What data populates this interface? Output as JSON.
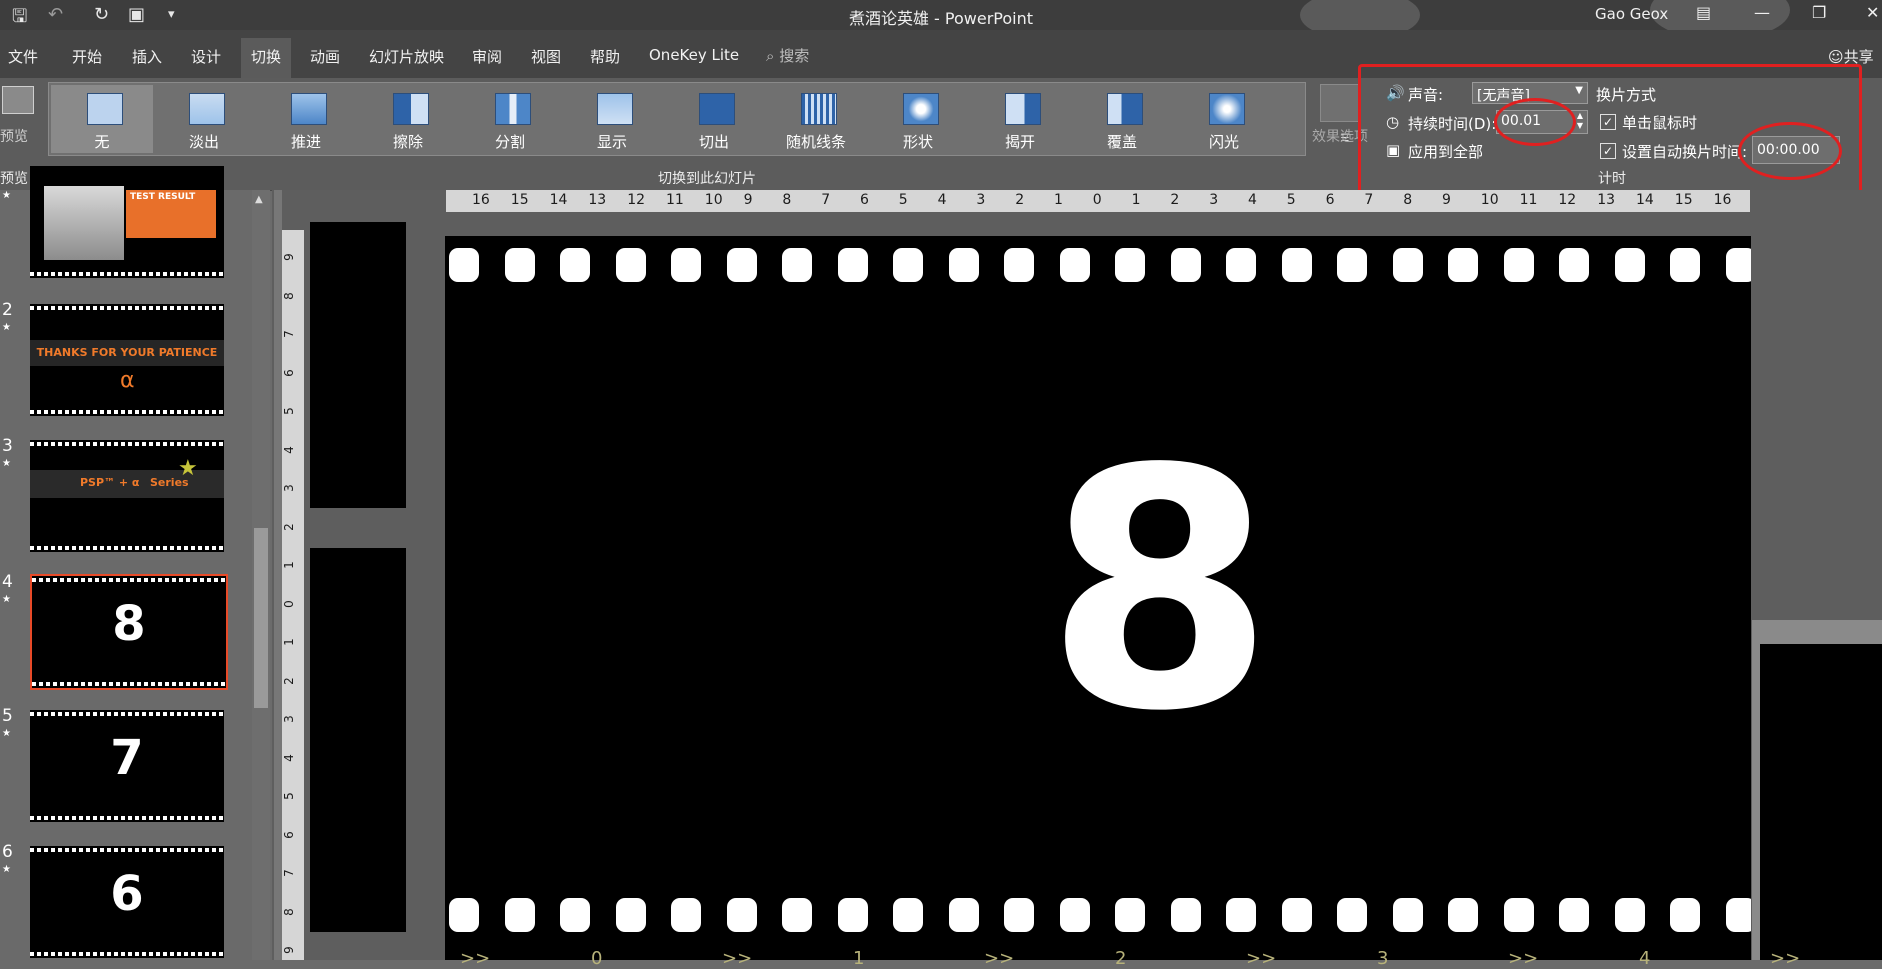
{
  "window": {
    "title": "煮酒论英雄  -  PowerPoint",
    "user": "Gao Geox"
  },
  "tabs": [
    "文件",
    "开始",
    "插入",
    "设计",
    "切换",
    "动画",
    "幻灯片放映",
    "审阅",
    "视图",
    "帮助",
    "OneKey Lite"
  ],
  "active_tab": "切换",
  "search_label": "搜索",
  "share_label": "共享",
  "ribbon": {
    "preview_label": "预览",
    "preview_group": "预览",
    "transitions": [
      "无",
      "淡出",
      "推进",
      "擦除",
      "分割",
      "显示",
      "切出",
      "随机线条",
      "形状",
      "揭开",
      "覆盖",
      "闪光"
    ],
    "selected_transition": "无",
    "effect_options": "效果选项",
    "transition_group": "切换到此幻灯片",
    "timing": {
      "sound_label": "声音:",
      "sound_value": "[无声音]",
      "duration_label": "持续时间(D):",
      "duration_value": "00.01",
      "apply_all": "应用到全部",
      "advance_header": "换片方式",
      "on_click": "单击鼠标时",
      "on_click_checked": true,
      "after_label": "设置自动换片时间:",
      "after_checked": true,
      "after_value": "00:00.00",
      "group_label": "计时"
    }
  },
  "slides": [
    {
      "number": "",
      "text": "TEST RESULT",
      "kind": "photo"
    },
    {
      "number": "2",
      "text": "THANKS FOR YOUR PATIENCE",
      "kind": "text"
    },
    {
      "number": "3",
      "text": "Series",
      "kind": "text"
    },
    {
      "number": "4",
      "text": "8",
      "kind": "count",
      "selected": true
    },
    {
      "number": "5",
      "text": "7",
      "kind": "count"
    },
    {
      "number": "6",
      "text": "6",
      "kind": "count"
    }
  ],
  "ruler_h": [
    "16",
    "15",
    "14",
    "13",
    "12",
    "11",
    "10",
    "9",
    "8",
    "7",
    "6",
    "5",
    "4",
    "3",
    "2",
    "1",
    "0",
    "1",
    "2",
    "3",
    "4",
    "5",
    "6",
    "7",
    "8",
    "9",
    "10",
    "11",
    "12",
    "13",
    "14",
    "15",
    "16"
  ],
  "ruler_v": [
    "9",
    "8",
    "7",
    "6",
    "5",
    "4",
    "3",
    "2",
    "1",
    "0",
    "1",
    "2",
    "3",
    "4",
    "5",
    "6",
    "7",
    "8",
    "9"
  ],
  "main_slide": {
    "number": "8",
    "bottom_marks": [
      ">>",
      "0",
      ">>",
      "1",
      ">>",
      "2",
      ">>",
      "3",
      ">>",
      "4",
      ">>"
    ]
  },
  "colors": {
    "annotation_red": "#e02020",
    "selected_border": "#e84a28",
    "background": "#6b6b6b"
  }
}
